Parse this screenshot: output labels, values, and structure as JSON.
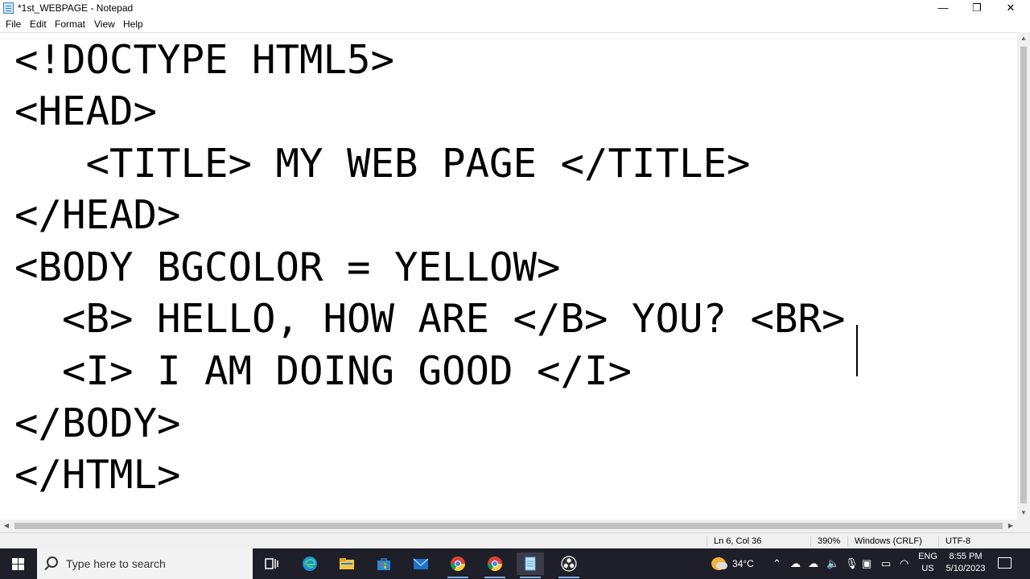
{
  "window": {
    "title": "*1st_WEBPAGE - Notepad",
    "minimize": "—",
    "maximize": "❐",
    "close": "✕"
  },
  "menu": {
    "file": "File",
    "edit": "Edit",
    "format": "Format",
    "view": "View",
    "help": "Help"
  },
  "editor": {
    "lines": [
      "<!DOCTYPE HTML5>",
      "<HEAD>",
      "   <TITLE> MY WEB PAGE </TITLE>",
      "</HEAD>",
      "<BODY BGCOLOR = YELLOW>",
      "  <B> HELLO, HOW ARE </B> YOU? <BR>",
      "  <I> I AM DOING GOOD </I>",
      "</BODY>",
      "</HTML>"
    ]
  },
  "status": {
    "position": "Ln 6, Col 36",
    "zoom": "390%",
    "line_ending": "Windows (CRLF)",
    "encoding": "UTF-8"
  },
  "taskbar": {
    "search_placeholder": "Type here to search",
    "weather_temp": "34°C",
    "language": "ENG",
    "region": "US",
    "time": "8:55 PM",
    "date": "5/10/2023",
    "pinned_icons": [
      "task-view-icon",
      "edge-icon",
      "file-explorer-icon",
      "microsoft-store-icon",
      "mail-icon",
      "chrome-icon",
      "chrome-alt-icon",
      "notepad-icon",
      "obs-icon"
    ],
    "tray_icons": [
      "chevron-up-icon",
      "onedrive-icon",
      "onedrive-icon",
      "volume-icon",
      "microphone-icon",
      "meet-now-icon",
      "battery-icon",
      "wifi-icon",
      "notifications-icon"
    ]
  }
}
